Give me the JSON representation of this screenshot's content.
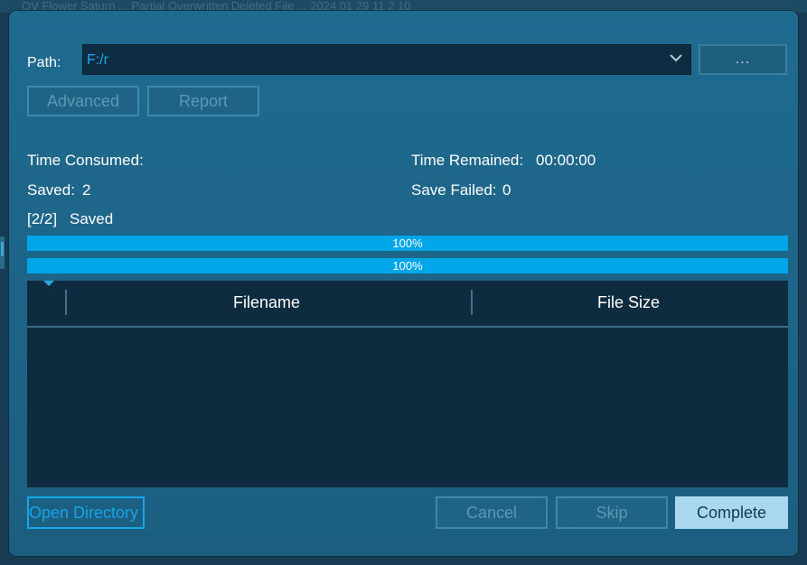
{
  "background": {
    "ghost_text": "OV Flower Saturn ... Partial Overwritten Deleted File ... 2024 01 29 11 2 10"
  },
  "dialog": {
    "path": {
      "label": "Path:",
      "value": "F:/r",
      "browse_label": "..."
    },
    "buttons": {
      "advanced": "Advanced",
      "report": "Report"
    },
    "stats": {
      "time_consumed_label": "Time Consumed:",
      "time_consumed_value": "",
      "time_remained_label": "Time Remained:",
      "time_remained_value": "00:00:00",
      "saved_label": "Saved:",
      "saved_value": "2",
      "save_failed_label": "Save Failed:",
      "save_failed_value": "0",
      "progress_counter": "[2/2]",
      "progress_status": "Saved"
    },
    "progress": [
      {
        "label": "100%",
        "percent": 100
      },
      {
        "label": "100%",
        "percent": 100
      }
    ],
    "table": {
      "columns": [
        "Filename",
        "File Size"
      ],
      "rows": []
    },
    "footer": {
      "open_directory": "Open Directory",
      "cancel": "Cancel",
      "skip": "Skip",
      "complete": "Complete"
    }
  },
  "colors": {
    "accent": "#00a6e8",
    "dialog_bg": "#1f6b90",
    "table_bg": "#0f2b3f",
    "complete_bg": "#a9d8ee"
  }
}
